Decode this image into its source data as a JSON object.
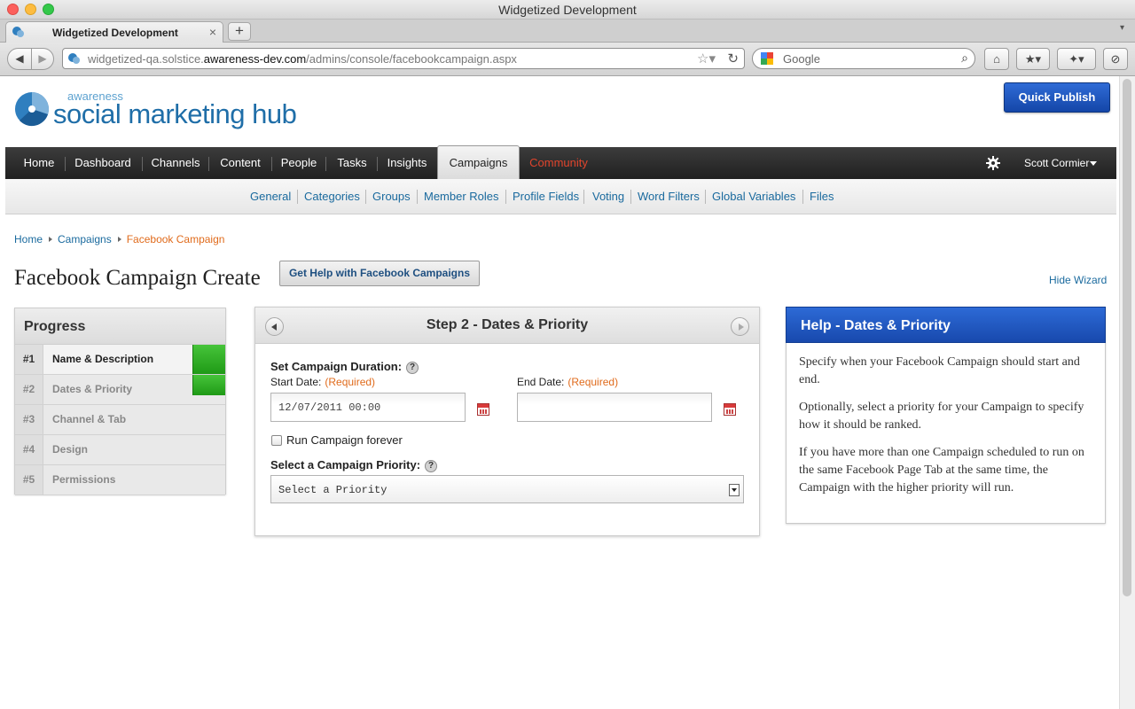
{
  "browser": {
    "window_title": "Widgetized Development",
    "tab_title": "Widgetized Development",
    "tab_close": "×",
    "new_tab": "+",
    "url_prefix": "widgetized-qa.solstice.",
    "url_domain": "awareness-dev.com",
    "url_path": "/admins/console/facebookcampaign.aspx",
    "search_placeholder": "Google"
  },
  "header": {
    "logo_small": "awareness",
    "logo_big": "social marketing hub",
    "quick_publish": "Quick Publish"
  },
  "mainnav": {
    "items": [
      "Home",
      "Dashboard",
      "Channels",
      "Content",
      "People",
      "Tasks",
      "Insights",
      "Campaigns",
      "Community"
    ],
    "active": "Campaigns",
    "user": "Scott Cormier"
  },
  "subnav": {
    "items": [
      "General",
      "Categories",
      "Groups",
      "Member Roles",
      "Profile Fields",
      "Voting",
      "Word Filters",
      "Global Variables",
      "Files"
    ]
  },
  "breadcrumb": [
    "Home",
    "Campaigns",
    "Facebook Campaign"
  ],
  "page": {
    "title": "Facebook Campaign Create",
    "help_button": "Get Help with Facebook Campaigns",
    "hide_wizard": "Hide Wizard"
  },
  "progress": {
    "title": "Progress",
    "steps": [
      {
        "num": "#1",
        "label": "Name & Description"
      },
      {
        "num": "#2",
        "label": "Dates & Priority"
      },
      {
        "num": "#3",
        "label": "Channel & Tab"
      },
      {
        "num": "#4",
        "label": "Design"
      },
      {
        "num": "#5",
        "label": "Permissions"
      }
    ]
  },
  "step": {
    "title": "Step 2 - Dates & Priority",
    "duration_label": "Set Campaign Duration:",
    "start_label": "Start Date:",
    "end_label": "End Date:",
    "required": "(Required)",
    "start_value": "12/07/2011 00:00",
    "end_value": "",
    "forever_label": "Run Campaign forever",
    "priority_label": "Select a Campaign Priority:",
    "priority_value": "Select a Priority",
    "help_glyph": "?"
  },
  "help": {
    "title": "Help - Dates & Priority",
    "paragraphs": [
      "Specify when your Facebook Campaign should start and end.",
      "Optionally, select a priority for your Campaign to specify how it should be ranked.",
      "If you have more than one Campaign scheduled to run on the same Facebook Page Tab at the same time, the Campaign with the higher priority will run."
    ]
  },
  "colors": {
    "accent_blue": "#1849ad",
    "link": "#1a6a9e",
    "required_orange": "#e06b1c",
    "complete_green": "#2fae25",
    "community_red": "#e0442c"
  },
  "icons": [
    "firefox-favicon",
    "back-arrow-icon",
    "forward-arrow-icon",
    "bookmark-star-icon",
    "reload-icon",
    "google-icon",
    "search-icon",
    "home-icon",
    "bookmarks-icon",
    "addon-icon",
    "calendar-icon",
    "gear-icon",
    "help-icon",
    "prev-arrow-icon",
    "next-arrow-icon",
    "dropdown-arrow-icon"
  ]
}
